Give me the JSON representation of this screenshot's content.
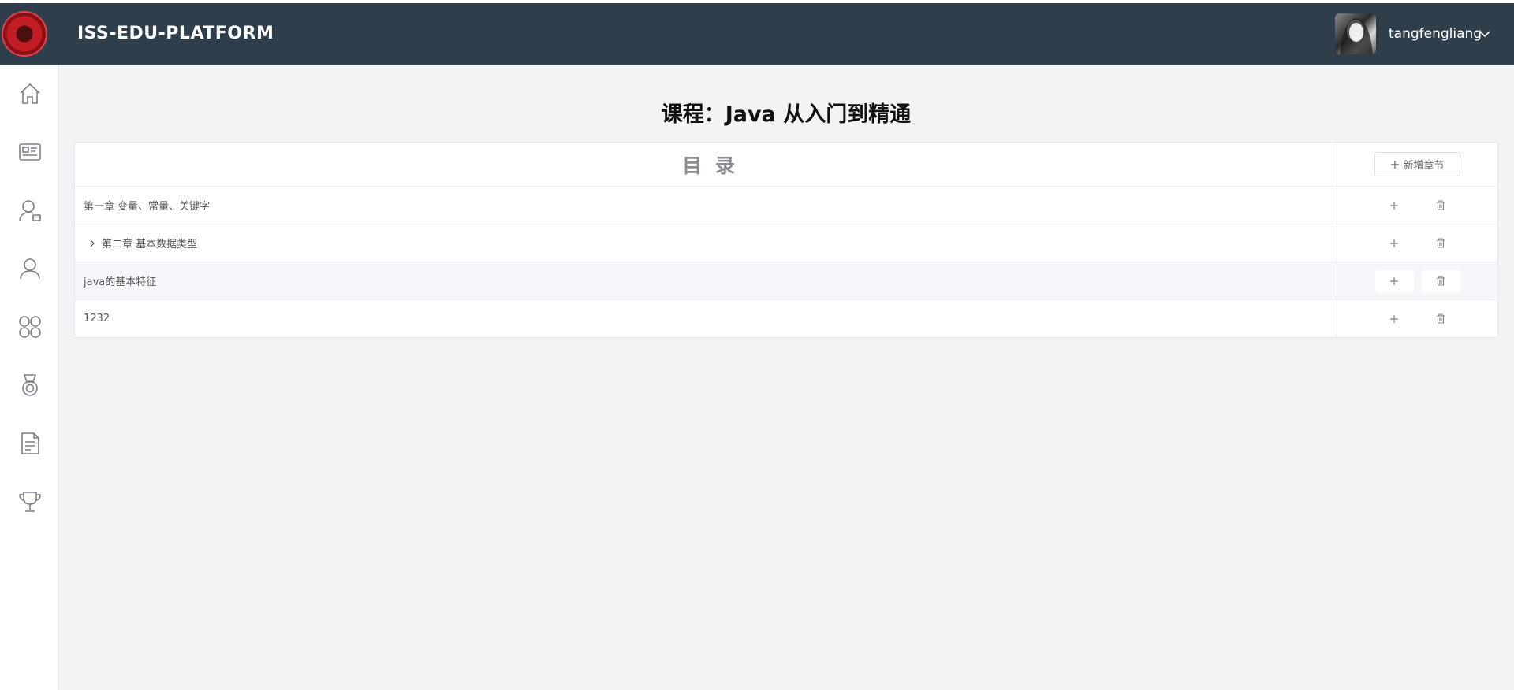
{
  "header": {
    "app_title": "ISS-EDU-PLATFORM",
    "username": "tangfengliang"
  },
  "sidebar": {
    "items": [
      {
        "icon": "home-icon"
      },
      {
        "icon": "id-card-icon"
      },
      {
        "icon": "user-badge-icon"
      },
      {
        "icon": "user-icon"
      },
      {
        "icon": "apps-icon"
      },
      {
        "icon": "medal-icon"
      },
      {
        "icon": "document-icon"
      },
      {
        "icon": "trophy-icon"
      }
    ]
  },
  "main": {
    "page_title": "课程：Java 从入门到精通",
    "toc": {
      "title": "目 录",
      "add_chapter_label": "新增章节",
      "rows": [
        {
          "label": "第一章 变量、常量、关键字",
          "expandable": false
        },
        {
          "label": "第二章 基本数据类型",
          "expandable": true
        },
        {
          "label": "java的基本特征",
          "expandable": false
        },
        {
          "label": "1232",
          "expandable": false
        }
      ]
    }
  }
}
